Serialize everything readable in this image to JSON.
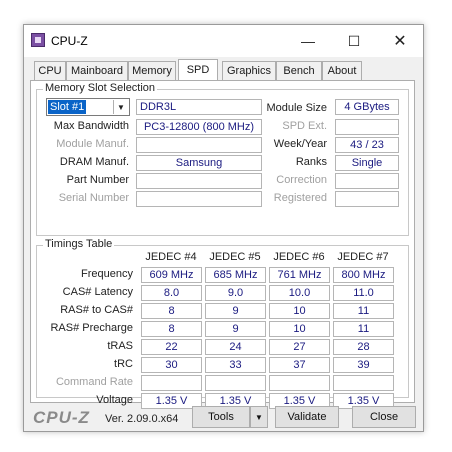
{
  "window": {
    "title": "CPU-Z",
    "minimize_icon": "minimize-icon",
    "maximize_icon": "maximize-icon",
    "close_icon": "close-icon"
  },
  "tabs": [
    {
      "label": "CPU"
    },
    {
      "label": "Mainboard"
    },
    {
      "label": "Memory"
    },
    {
      "label": "SPD",
      "active": true
    },
    {
      "label": "Graphics"
    },
    {
      "label": "Bench"
    },
    {
      "label": "About"
    }
  ],
  "slot": {
    "group_title": "Memory Slot Selection",
    "selected_slot": "Slot #1",
    "type": "DDR3L",
    "labels": {
      "max_bandwidth": "Max Bandwidth",
      "module_manuf": "Module Manuf.",
      "dram_manuf": "DRAM Manuf.",
      "part_number": "Part Number",
      "serial_number": "Serial Number",
      "module_size": "Module Size",
      "spd_ext": "SPD Ext.",
      "week_year": "Week/Year",
      "ranks": "Ranks",
      "correction": "Correction",
      "registered": "Registered"
    },
    "values": {
      "max_bandwidth": "PC3-12800 (800 MHz)",
      "module_manuf": "",
      "dram_manuf": "Samsung",
      "part_number": "",
      "serial_number": "",
      "module_size": "4 GBytes",
      "spd_ext": "",
      "week_year": "43 / 23",
      "ranks": "Single",
      "correction": "",
      "registered": ""
    }
  },
  "timings": {
    "group_title": "Timings Table",
    "columns": [
      "JEDEC #4",
      "JEDEC #5",
      "JEDEC #6",
      "JEDEC #7"
    ],
    "row_labels": [
      "Frequency",
      "CAS# Latency",
      "RAS# to CAS#",
      "RAS# Precharge",
      "tRAS",
      "tRC",
      "Command Rate",
      "Voltage"
    ],
    "rows": [
      [
        "609 MHz",
        "685 MHz",
        "761 MHz",
        "800 MHz"
      ],
      [
        "8.0",
        "9.0",
        "10.0",
        "11.0"
      ],
      [
        "8",
        "9",
        "10",
        "11"
      ],
      [
        "8",
        "9",
        "10",
        "11"
      ],
      [
        "22",
        "24",
        "27",
        "28"
      ],
      [
        "30",
        "33",
        "37",
        "39"
      ],
      [
        "",
        "",
        "",
        ""
      ],
      [
        "1.35 V",
        "1.35 V",
        "1.35 V",
        "1.35 V"
      ]
    ]
  },
  "footer": {
    "logo": "CPU-Z",
    "version": "Ver. 2.09.0.x64",
    "tools_label": "Tools",
    "validate_label": "Validate",
    "close_label": "Close"
  }
}
